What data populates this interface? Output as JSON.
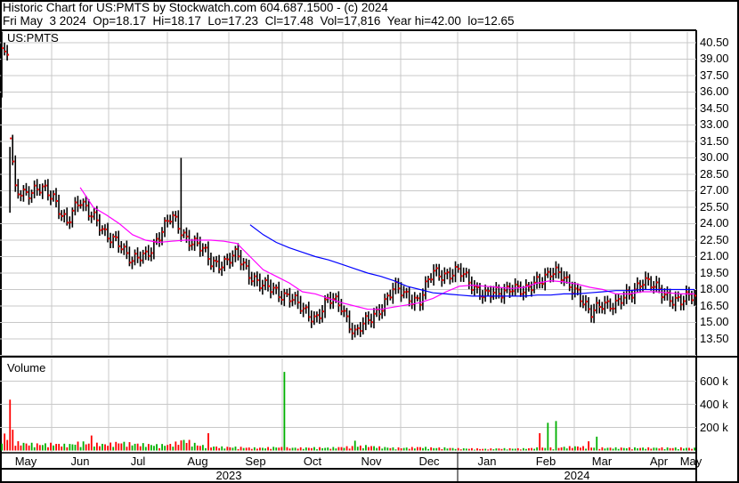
{
  "header": {
    "title": "Historic Chart for US:PMTS by Stockwatch.com 604.687.1500 - (c) 2024",
    "quote": "Fri May  3 2024  Op=18.17  Hi=18.17  Lo=17.23  Cl=17.48  Vol=17,816  Year hi=42.00  lo=12.65"
  },
  "chart_data": {
    "type": "ohlc-bar",
    "symbol": "US:PMTS",
    "volume_label": "Volume",
    "price_ticks": [
      "13.50",
      "15.00",
      "16.50",
      "18.00",
      "19.50",
      "21.00",
      "22.50",
      "24.00",
      "25.50",
      "27.00",
      "28.50",
      "30.00",
      "31.50",
      "33.00",
      "34.50",
      "36.00",
      "37.50",
      "39.00",
      "40.50"
    ],
    "ylim": [
      12.5,
      41.5
    ],
    "volume_ticks": [
      "200 k",
      "400 k",
      "600 k"
    ],
    "months": [
      "May",
      "Jun",
      "Jul",
      "Aug",
      "Sep",
      "Oct",
      "Nov",
      "Dec",
      "Jan",
      "Feb",
      "Mar",
      "Apr",
      "May"
    ],
    "years": [
      "2023",
      "2024"
    ],
    "weekly_close": [
      40,
      27,
      27,
      27,
      26.5,
      24,
      26,
      25,
      22.5,
      22.5,
      20.5,
      21,
      23,
      24.5,
      23,
      22,
      20.5,
      20.5,
      21,
      19.5,
      18.2,
      17.8,
      17.5,
      16,
      15.5,
      17,
      16.5,
      14,
      15,
      16.5,
      18,
      17.5,
      17,
      19.5,
      19.5,
      19.5,
      18.5,
      17.5,
      17.5,
      18.5,
      17.5,
      19,
      19.5,
      19,
      18,
      15.5,
      17,
      16.5,
      17.5,
      19,
      18,
      17.5,
      16.8,
      17.48
    ],
    "ma_magenta": [
      null,
      null,
      null,
      null,
      null,
      null,
      27.3,
      25.5,
      24.8,
      24,
      23,
      22.5,
      22.3,
      22.4,
      22.5,
      22.5,
      22.5,
      22.4,
      22.2,
      21,
      19.8,
      19.2,
      18.6,
      17.8,
      17.6,
      17.2,
      16.8,
      16.5,
      16.2,
      16.2,
      16.4,
      16.6,
      16.8,
      17.2,
      17.8,
      18.3,
      18.4,
      18.3,
      18.2,
      18.1,
      18.2,
      18.6,
      18.8,
      18.7,
      18.5,
      18.2,
      18,
      17.6,
      17.6,
      17.8,
      17.8,
      17.7,
      17.6,
      17.6
    ],
    "ma_blue": [
      null,
      null,
      null,
      null,
      null,
      null,
      null,
      null,
      null,
      null,
      null,
      null,
      null,
      null,
      null,
      null,
      null,
      null,
      null,
      23.9,
      23,
      22.3,
      21.8,
      21.4,
      21,
      20.7,
      20.3,
      19.9,
      19.5,
      19.2,
      18.8,
      18.3,
      18,
      17.7,
      17.6,
      17.5,
      17.4,
      17.4,
      17.4,
      17.4,
      17.4,
      17.5,
      17.5,
      17.6,
      17.6,
      17.7,
      17.8,
      17.9,
      17.9,
      18,
      18,
      18,
      18,
      18
    ],
    "weekly_volume_k": [
      120,
      60,
      50,
      45,
      50,
      40,
      60,
      50,
      45,
      60,
      50,
      45,
      40,
      45,
      80,
      40,
      30,
      25,
      25,
      20,
      20,
      25,
      20,
      20,
      22,
      20,
      25,
      30,
      35,
      25,
      20,
      20,
      25,
      20,
      20,
      15,
      15,
      12,
      15,
      15,
      15,
      20,
      20,
      25,
      30,
      25,
      20,
      20,
      20,
      20,
      20,
      20,
      20,
      18
    ],
    "volume_spikes": [
      {
        "day": 3,
        "k": 440
      },
      {
        "day": 4,
        "k": 180
      },
      {
        "day": 33,
        "k": 130
      },
      {
        "day": 104,
        "k": 680
      },
      {
        "day": 76,
        "k": 150
      },
      {
        "day": 201,
        "k": 240
      },
      {
        "day": 204,
        "k": 255
      },
      {
        "day": 198,
        "k": 150
      },
      {
        "day": 130,
        "k": 85
      },
      {
        "day": 216,
        "k": 80
      },
      {
        "day": 661,
        "k": 0
      },
      {
        "day": 219,
        "k": 120
      }
    ]
  },
  "colors": {
    "up": "#00b000",
    "down": "#ff0000",
    "bar": "#000000",
    "grid": "#c8c8c8",
    "ma_short": "#ff00ff",
    "ma_long": "#0000ff"
  }
}
